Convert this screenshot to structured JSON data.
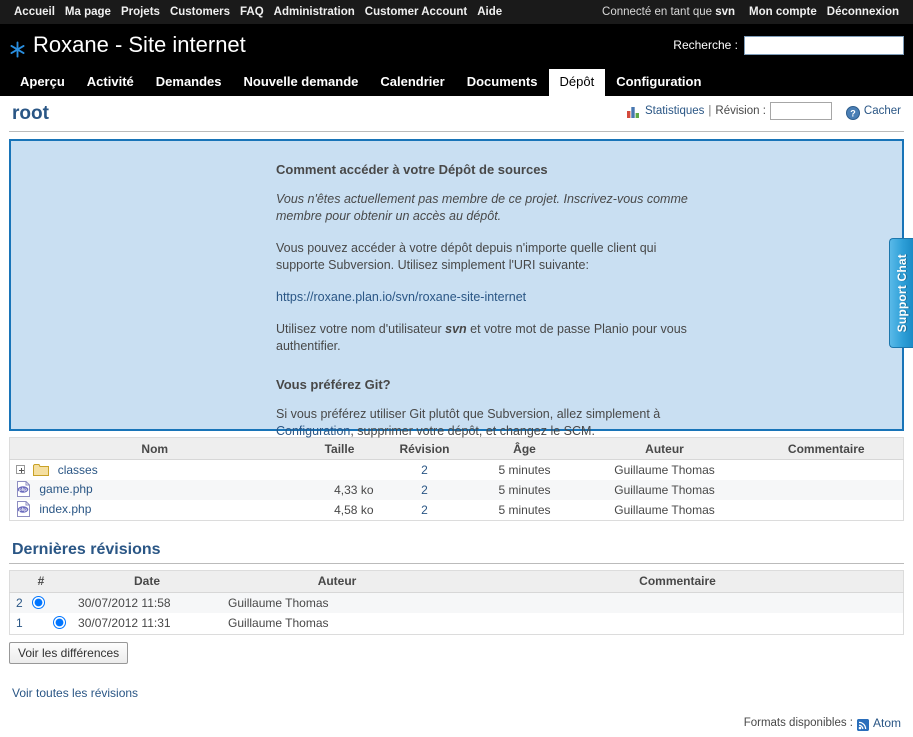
{
  "top_menu": {
    "left_items": [
      {
        "label": "Accueil",
        "name": "accueil"
      },
      {
        "label": "Ma page",
        "name": "ma-page"
      },
      {
        "label": "Projets",
        "name": "projets"
      },
      {
        "label": "Customers",
        "name": "customers"
      },
      {
        "label": "FAQ",
        "name": "faq"
      },
      {
        "label": "Administration",
        "name": "administration"
      },
      {
        "label": "Customer Account",
        "name": "customer-account"
      },
      {
        "label": "Aide",
        "name": "aide"
      }
    ],
    "logged_as_prefix": "Connecté en tant que ",
    "logged_as_user": "svn",
    "my_account": "Mon compte",
    "logout": "Déconnexion"
  },
  "header": {
    "title": "Roxane - Site internet",
    "logo_icon": "snowflake-icon",
    "accent_color": "#2a8fe0",
    "search_label": "Recherche :",
    "search_value": "",
    "search_placeholder": ""
  },
  "main_tabs": [
    {
      "label": "Aperçu",
      "name": "apercu",
      "selected": false
    },
    {
      "label": "Activité",
      "name": "activite",
      "selected": false
    },
    {
      "label": "Demandes",
      "name": "demandes",
      "selected": false
    },
    {
      "label": "Nouvelle demande",
      "name": "nouvelle-demande",
      "selected": false
    },
    {
      "label": "Calendrier",
      "name": "calendrier",
      "selected": false
    },
    {
      "label": "Documents",
      "name": "documents",
      "selected": false
    },
    {
      "label": "Dépôt",
      "name": "depot",
      "selected": true
    },
    {
      "label": "Configuration",
      "name": "configuration",
      "selected": false
    }
  ],
  "content": {
    "page_title": "root",
    "contextual": {
      "statistics_label": "Statistiques",
      "separator": "|",
      "revision_label": "Révision :",
      "revision_value": "",
      "hide_label": "Cacher"
    },
    "scm_info": {
      "heading": "Comment accéder à votre Dépôt de sources",
      "not_member_text": "Vous n'êtes actuellement pas membre de ce projet. Inscrivez-vous comme membre pour obtenir un accès au dépôt.",
      "access_text": "Vous pouvez accéder à votre dépôt depuis n'importe quelle client qui supporte Subversion. Utilisez simplement l'URI suivante:",
      "repo_url": "https://roxane.plan.io/svn/roxane-site-internet",
      "auth_text_before": "Utilisez votre nom d'utilisateur ",
      "auth_username": "svn",
      "auth_text_after": " et votre mot de passe Planio pour vous authentifier.",
      "git_heading": "Vous préférez Git?",
      "git_text_before": "Si vous préférez utiliser Git plutôt que Subversion, allez simplement à ",
      "git_link": "Configuration",
      "git_text_after": ", supprimer votre dépôt, et changez le SCM."
    },
    "file_table": {
      "headers": [
        "Nom",
        "Taille",
        "Révision",
        "Âge",
        "Auteur",
        "Commentaire"
      ],
      "rows": [
        {
          "icon": "folder-icon",
          "name": "classes",
          "is_dir": true,
          "size": "",
          "revision": "2",
          "age": "5 minutes",
          "author": "Guillaume Thomas",
          "comment": ""
        },
        {
          "icon": "php-file-icon",
          "name": "game.php",
          "is_dir": false,
          "size": "4,33 ko",
          "revision": "2",
          "age": "5 minutes",
          "author": "Guillaume Thomas",
          "comment": ""
        },
        {
          "icon": "php-file-icon",
          "name": "index.php",
          "is_dir": false,
          "size": "4,58 ko",
          "revision": "2",
          "age": "5 minutes",
          "author": "Guillaume Thomas",
          "comment": ""
        }
      ]
    },
    "revisions_section": {
      "title": "Dernières révisions",
      "headers": [
        "#",
        "Date",
        "Auteur",
        "Commentaire"
      ],
      "rows": [
        {
          "id": "2",
          "date": "30/07/2012 11:58",
          "author": "Guillaume Thomas",
          "comment": "",
          "radio_left_checked": true,
          "radio_right_checked": false
        },
        {
          "id": "1",
          "date": "30/07/2012 11:31",
          "author": "Guillaume Thomas",
          "comment": "",
          "radio_left_checked": false,
          "radio_right_checked": true
        }
      ],
      "diff_button": "Voir les différences",
      "view_all_link": "Voir toutes les révisions"
    },
    "other_formats": {
      "label": "Formats disponibles :",
      "atom_label": "Atom"
    }
  },
  "support_chat": {
    "label": "Support Chat"
  }
}
